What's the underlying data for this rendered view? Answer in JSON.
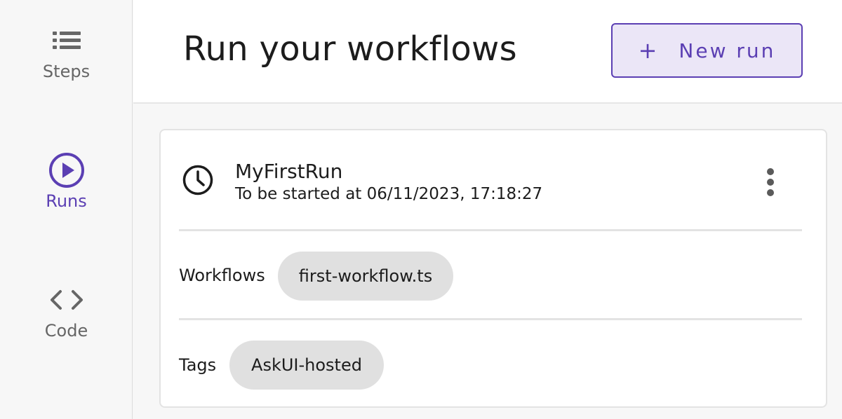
{
  "sidebar": {
    "items": [
      {
        "label": "Steps",
        "icon": "list-icon",
        "active": false
      },
      {
        "label": "Runs",
        "icon": "play-circle-icon",
        "active": true
      },
      {
        "label": "Code",
        "icon": "code-icon",
        "active": false
      }
    ]
  },
  "header": {
    "title": "Run your workflows",
    "new_run_label": "New run",
    "new_run_icon": "plus-icon"
  },
  "run_card": {
    "name": "MyFirstRun",
    "schedule": "To be started at 06/11/2023, 17:18:27",
    "status_icon": "clock-icon",
    "menu_icon": "more-vertical-icon",
    "workflows_label": "Workflows",
    "workflows": [
      "first-workflow.ts"
    ],
    "tags_label": "Tags",
    "tags": [
      "AskUI-hosted"
    ]
  },
  "colors": {
    "accent": "#5b3fb3",
    "accent_bg": "#ebe6f7",
    "chip_bg": "#e0e0e0",
    "sidebar_bg": "#f7f7f7",
    "text_muted": "#666666"
  }
}
